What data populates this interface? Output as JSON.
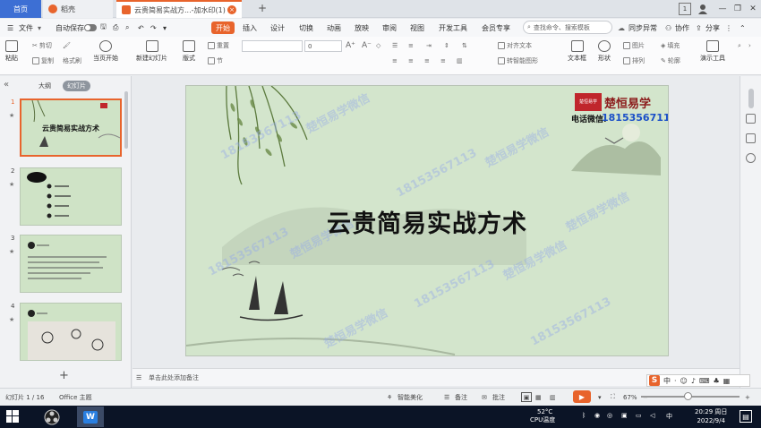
{
  "tabs": {
    "home": "首页",
    "shell": "稻壳",
    "document": "云贵简易实战方...-加水印(1)",
    "new_tab": "+"
  },
  "menu": {
    "file": "文件",
    "autosave": "自动保存",
    "start": "开始",
    "insert": "插入",
    "design": "设计",
    "transition": "切换",
    "animation": "动画",
    "slideshow": "放映",
    "review": "审阅",
    "view": "视图",
    "devtools": "开发工具",
    "member": "会员专享",
    "search_placeholder": "查找命令、搜索模板",
    "sync": "同步异常",
    "collab": "协作",
    "share": "分享"
  },
  "ribbon": {
    "paste": "粘贴",
    "cut": "剪切",
    "copy": "复制",
    "format_painter": "格式刷",
    "from_current": "当页开始",
    "new_slide": "新建幻灯片",
    "layout": "版式",
    "reset": "重置",
    "section": "节",
    "font_size": "0",
    "bold": "B",
    "italic": "I",
    "underline": "U",
    "strike": "S",
    "text_shadow": "S",
    "align_text": "对齐文本",
    "convert_smartart": "转智能图形",
    "textbox": "文本框",
    "shape": "形状",
    "picture": "图片",
    "arrange": "排列",
    "fill": "填充",
    "outline": "轮廓",
    "presenter_tools": "演示工具"
  },
  "left_panel": {
    "tab_outline": "大纲",
    "tab_slides": "幻灯片",
    "slide_numbers": [
      "1",
      "2",
      "3",
      "4"
    ],
    "thumb1_title": "云贵简易实战方术",
    "add_slide": "+"
  },
  "slide": {
    "title": "云贵简易实战方术",
    "logo_seal": "楚恒易学",
    "logo_text": "楚恒易学",
    "contact_label": "电话微信:",
    "contact_phone": "18153567113",
    "watermark_phone": "18153567113",
    "watermark_text": "楚恒易学微信"
  },
  "notes": {
    "placeholder": "单击此处添加备注"
  },
  "status": {
    "slide_counter": "幻灯片 1 / 16",
    "theme": "Office 主题",
    "beautify": "智能美化",
    "notes": "备注",
    "comments": "批注",
    "zoom": "67%"
  },
  "ime": {
    "lang": "中"
  },
  "taskbar": {
    "temperature": "52°C",
    "cpu": "CPU温度",
    "lang": "中",
    "time": "20:29 周日",
    "date": "2022/9/4"
  },
  "colors": {
    "accent": "#e8642c",
    "home_tab": "#3d6fd4",
    "slide_bg": "#d3e5cc",
    "phone_blue": "#1a4fc8",
    "seal_red": "#c0262c"
  }
}
